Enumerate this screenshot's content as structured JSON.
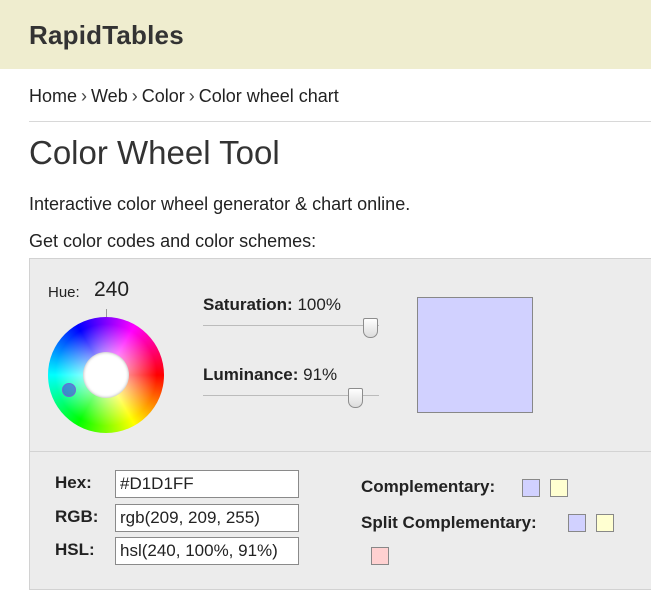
{
  "header": {
    "logo": "RapidTables"
  },
  "breadcrumb": {
    "items": [
      "Home",
      "Web",
      "Color",
      "Color wheel chart"
    ],
    "separator": "›"
  },
  "page": {
    "title": "Color Wheel Tool",
    "description_1": "Interactive color wheel generator & chart online.",
    "description_2": "Get color codes and color schemes:"
  },
  "tool": {
    "hue_label": "Hue:",
    "hue_value": "240",
    "saturation_label": "Saturation:",
    "saturation_value": "100%",
    "saturation_level": 1.0,
    "luminance_label": "Luminance:",
    "luminance_value": "91%",
    "luminance_level": 0.91,
    "swatch_color": "#D1D1FF",
    "fields": {
      "hex_label": "Hex:",
      "hex_value": "#D1D1FF",
      "rgb_label": "RGB:",
      "rgb_value": "rgb(209, 209, 255)",
      "hsl_label": "HSL:",
      "hsl_value": "hsl(240, 100%, 91%)"
    },
    "schemes": {
      "complementary_label": "Complementary:",
      "complementary_colors": [
        "#D1D1FF",
        "#FFFFD1"
      ],
      "split_label": "Split Complementary:",
      "split_colors": [
        "#D1D1FF",
        "#FFFFD1",
        "#FFD1D1"
      ]
    }
  }
}
